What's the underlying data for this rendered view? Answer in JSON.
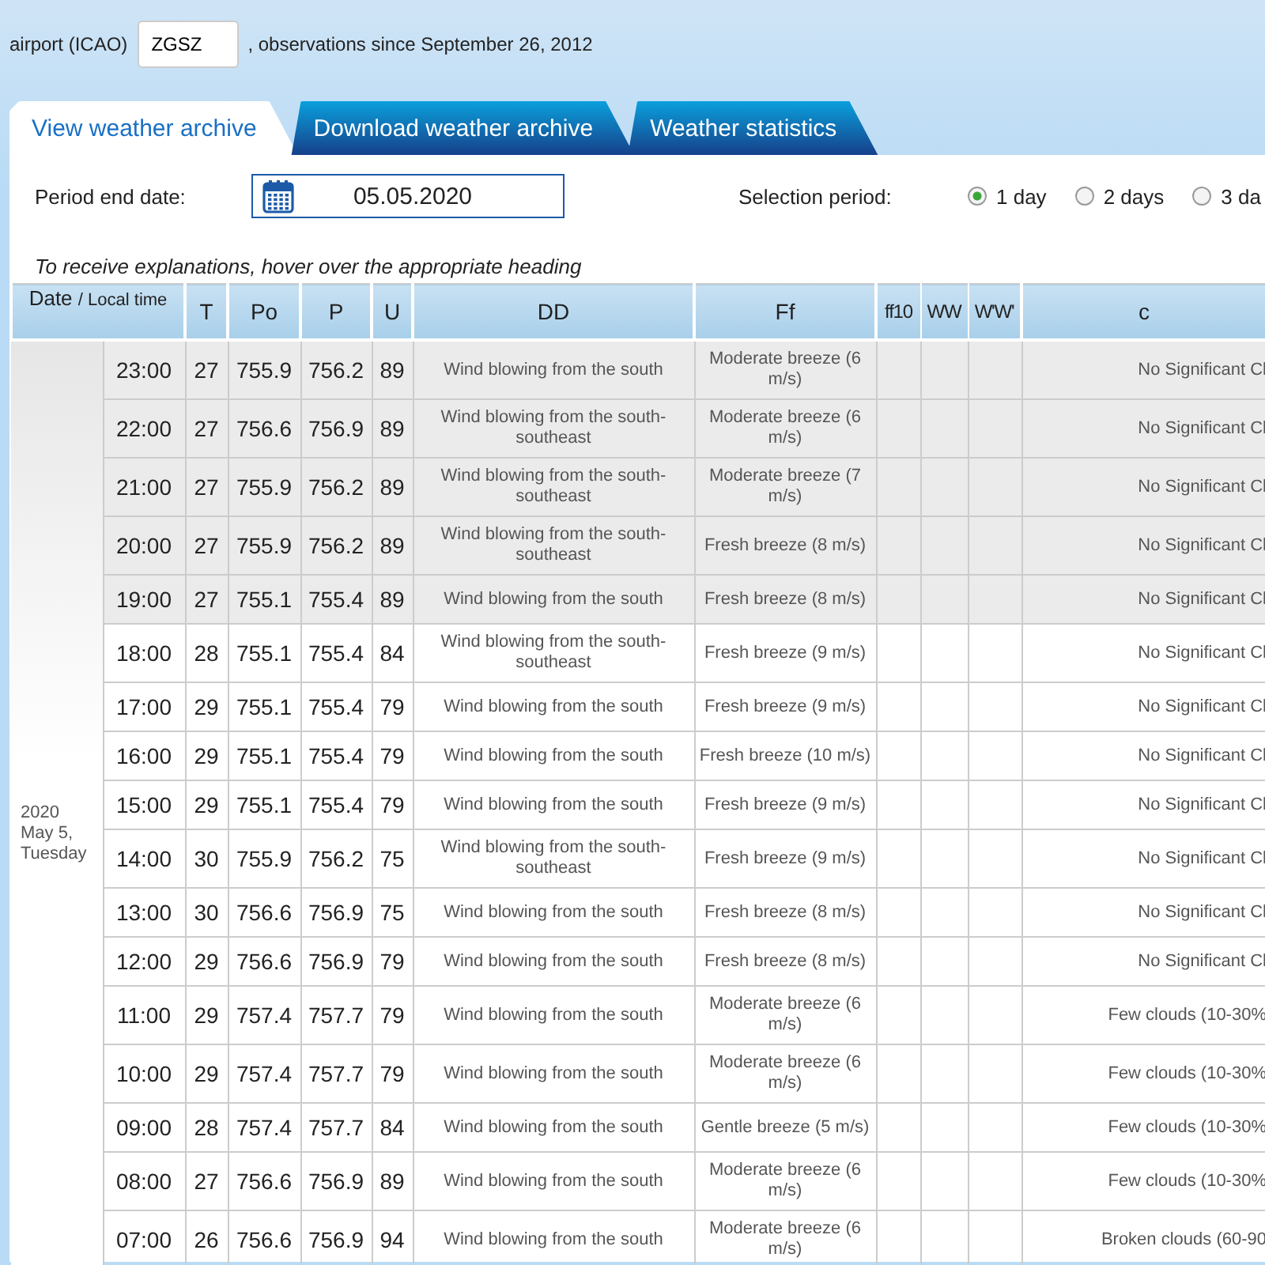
{
  "station": {
    "label": "airport (ICAO)",
    "code": "ZGSZ",
    "since": ", observations since September 26, 2012"
  },
  "tabs": [
    {
      "label": "View weather archive",
      "selected": true
    },
    {
      "label": "Download weather archive",
      "selected": false
    },
    {
      "label": "Weather statistics",
      "selected": false
    }
  ],
  "period": {
    "label": "Period end date:",
    "date": "05.05.2020",
    "selection_label": "Selection period:",
    "options": [
      {
        "label": "1 day",
        "selected": true
      },
      {
        "label": "2 days",
        "selected": false
      },
      {
        "label": "3 da",
        "selected": false
      }
    ]
  },
  "hint": "To receive explanations, hover over the appropriate heading",
  "table": {
    "date_header": {
      "label": "Date",
      "sublabel": "/ Local time"
    },
    "columns": [
      "T",
      "Po",
      "P",
      "U",
      "DD",
      "Ff",
      "ff10",
      "WW",
      "W'W'",
      "c"
    ],
    "date_lines": [
      "2020",
      "May 5,",
      "Tuesday"
    ],
    "rows": [
      {
        "time": "23:00",
        "highlighted": true,
        "cells": [
          "27",
          "755.9",
          "756.2",
          "89",
          "Wind blowing from the south",
          "Moderate breeze (6 m/s)",
          "",
          "",
          "",
          "No Significant Cl"
        ]
      },
      {
        "time": "22:00",
        "highlighted": true,
        "cells": [
          "27",
          "756.6",
          "756.9",
          "89",
          "Wind blowing from the south-southeast",
          "Moderate breeze (6 m/s)",
          "",
          "",
          "",
          "No Significant Cl"
        ]
      },
      {
        "time": "21:00",
        "highlighted": true,
        "cells": [
          "27",
          "755.9",
          "756.2",
          "89",
          "Wind blowing from the south-southeast",
          "Moderate breeze (7 m/s)",
          "",
          "",
          "",
          "No Significant Cl"
        ]
      },
      {
        "time": "20:00",
        "highlighted": true,
        "cells": [
          "27",
          "755.9",
          "756.2",
          "89",
          "Wind blowing from the south-southeast",
          "Fresh breeze (8 m/s)",
          "",
          "",
          "",
          "No Significant Cl"
        ]
      },
      {
        "time": "19:00",
        "highlighted": true,
        "cells": [
          "27",
          "755.1",
          "755.4",
          "89",
          "Wind blowing from the south",
          "Fresh breeze (8 m/s)",
          "",
          "",
          "",
          "No Significant Cl"
        ]
      },
      {
        "time": "18:00",
        "highlighted": false,
        "cells": [
          "28",
          "755.1",
          "755.4",
          "84",
          "Wind blowing from the south-southeast",
          "Fresh breeze (9 m/s)",
          "",
          "",
          "",
          "No Significant Cl"
        ]
      },
      {
        "time": "17:00",
        "highlighted": false,
        "cells": [
          "29",
          "755.1",
          "755.4",
          "79",
          "Wind blowing from the south",
          "Fresh breeze (9 m/s)",
          "",
          "",
          "",
          "No Significant Cl"
        ]
      },
      {
        "time": "16:00",
        "highlighted": false,
        "cells": [
          "29",
          "755.1",
          "755.4",
          "79",
          "Wind blowing from the south",
          "Fresh breeze (10 m/s)",
          "",
          "",
          "",
          "No Significant Cl"
        ]
      },
      {
        "time": "15:00",
        "highlighted": false,
        "cells": [
          "29",
          "755.1",
          "755.4",
          "79",
          "Wind blowing from the south",
          "Fresh breeze (9 m/s)",
          "",
          "",
          "",
          "No Significant Cl"
        ]
      },
      {
        "time": "14:00",
        "highlighted": false,
        "cells": [
          "30",
          "755.9",
          "756.2",
          "75",
          "Wind blowing from the south-southeast",
          "Fresh breeze (9 m/s)",
          "",
          "",
          "",
          "No Significant Cl"
        ]
      },
      {
        "time": "13:00",
        "highlighted": false,
        "cells": [
          "30",
          "756.6",
          "756.9",
          "75",
          "Wind blowing from the south",
          "Fresh breeze (8 m/s)",
          "",
          "",
          "",
          "No Significant Cl"
        ]
      },
      {
        "time": "12:00",
        "highlighted": false,
        "cells": [
          "29",
          "756.6",
          "756.9",
          "79",
          "Wind blowing from the south",
          "Fresh breeze (8 m/s)",
          "",
          "",
          "",
          "No Significant Cl"
        ]
      },
      {
        "time": "11:00",
        "highlighted": false,
        "cells": [
          "29",
          "757.4",
          "757.7",
          "79",
          "Wind blowing from the south",
          "Moderate breeze (6 m/s)",
          "",
          "",
          "",
          "Few clouds (10-30%"
        ]
      },
      {
        "time": "10:00",
        "highlighted": false,
        "cells": [
          "29",
          "757.4",
          "757.7",
          "79",
          "Wind blowing from the south",
          "Moderate breeze (6 m/s)",
          "",
          "",
          "",
          "Few clouds (10-30%"
        ]
      },
      {
        "time": "09:00",
        "highlighted": false,
        "cells": [
          "28",
          "757.4",
          "757.7",
          "84",
          "Wind blowing from the south",
          "Gentle breeze (5 m/s)",
          "",
          "",
          "",
          "Few clouds (10-30%"
        ]
      },
      {
        "time": "08:00",
        "highlighted": false,
        "cells": [
          "27",
          "756.6",
          "756.9",
          "89",
          "Wind blowing from the south",
          "Moderate breeze (6 m/s)",
          "",
          "",
          "",
          "Few clouds (10-30%"
        ]
      },
      {
        "time": "07:00",
        "highlighted": false,
        "cells": [
          "26",
          "756.6",
          "756.9",
          "94",
          "Wind blowing from the south",
          "Moderate breeze (6 m/s)",
          "",
          "",
          "",
          "Broken clouds (60-90"
        ]
      }
    ]
  }
}
